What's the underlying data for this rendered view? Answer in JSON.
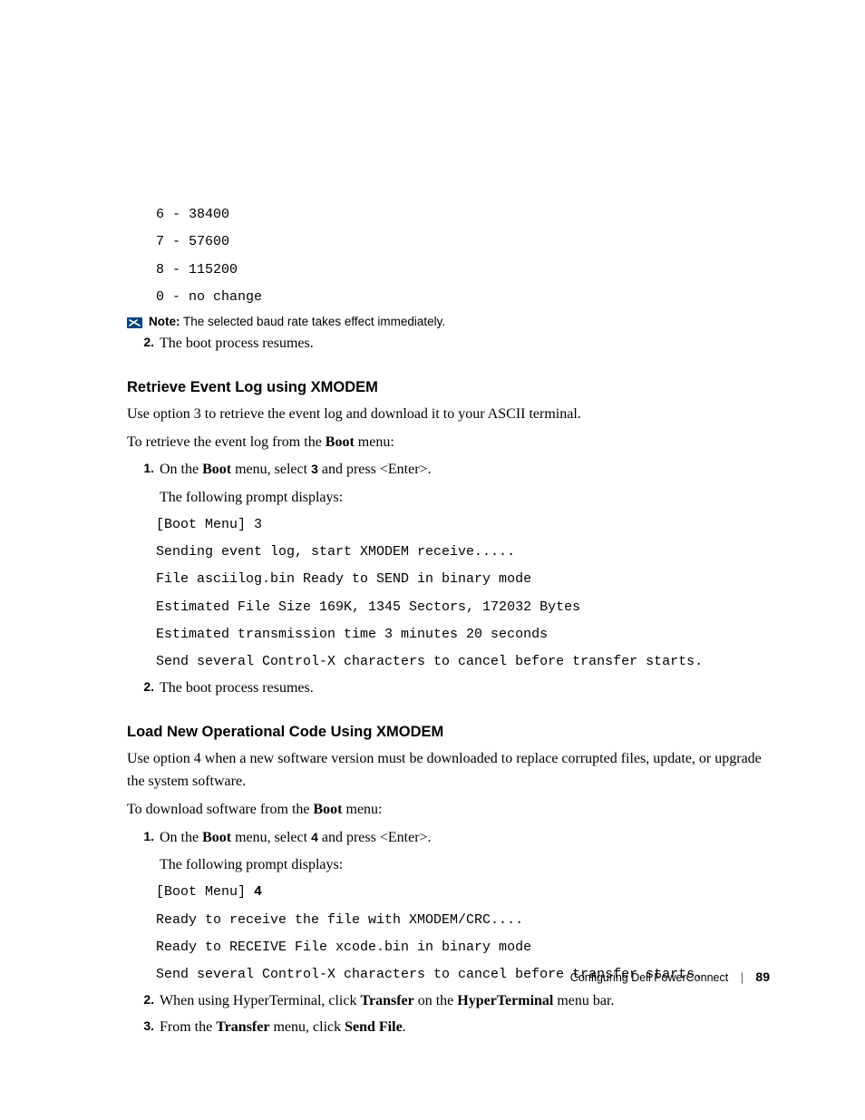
{
  "baud_options": [
    "6 - 38400",
    "7 - 57600",
    "8 - 115200",
    "0 - no change"
  ],
  "note": {
    "label": "Note:",
    "text": "The selected baud rate takes effect immediately."
  },
  "resume_step": {
    "num": "2.",
    "text": "The boot process resumes."
  },
  "section_xmodem_log": {
    "heading": "Retrieve Event Log using XMODEM",
    "intro": "Use option 3 to retrieve the event log and download it to your ASCII terminal.",
    "lead_pre": "To retrieve the event log from the ",
    "lead_bold": "Boot",
    "lead_post": " menu:",
    "step1": {
      "num": "1.",
      "pre": "On the ",
      "b1": "Boot",
      "mid1": " menu, select ",
      "sel": "3",
      "mid2": " and press <Enter>.",
      "sub": "The following prompt displays:"
    },
    "terminal": [
      "[Boot Menu] 3",
      "Sending event log, start XMODEM receive.....",
      "File asciilog.bin Ready to SEND in binary mode",
      "Estimated File Size 169K, 1345 Sectors, 172032 Bytes",
      "Estimated transmission time 3 minutes 20 seconds",
      "Send several Control-X characters to cancel before transfer starts."
    ],
    "step2": {
      "num": "2.",
      "text": "The boot process resumes."
    }
  },
  "section_load_code": {
    "heading": "Load New Operational Code Using XMODEM",
    "intro": "Use option 4 when a new software version must be downloaded to replace corrupted files, update, or upgrade the system software.",
    "lead_pre": "To download software from the ",
    "lead_bold": "Boot",
    "lead_post": " menu:",
    "step1": {
      "num": "1.",
      "pre": "On the ",
      "b1": "Boot",
      "mid1": " menu, select ",
      "sel": "4",
      "mid2": " and press <Enter>.",
      "sub": "The following prompt displays:"
    },
    "terminal_pre": "[Boot Menu] ",
    "terminal_bold": "4",
    "terminal_rest": [
      "Ready to receive the file with XMODEM/CRC....",
      "Ready to RECEIVE File xcode.bin in binary mode",
      "Send several Control-X characters to cancel before transfer starts."
    ],
    "step2": {
      "num": "2.",
      "pre": "When using HyperTerminal, click ",
      "b1": "Transfer",
      "mid": " on the ",
      "b2": "HyperTerminal",
      "post": " menu bar."
    },
    "step3": {
      "num": "3.",
      "pre": "From the ",
      "b1": "Transfer",
      "mid": " menu, click ",
      "b2": "Send File",
      "post": "."
    }
  },
  "footer": {
    "title": "Configuring Dell PowerConnect",
    "page": "89"
  }
}
